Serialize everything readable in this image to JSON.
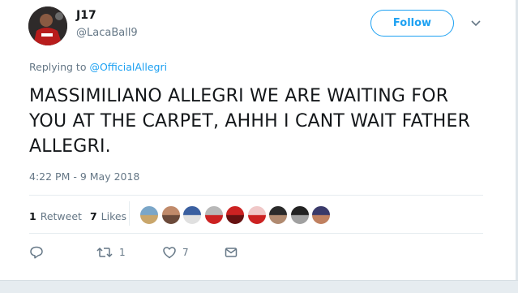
{
  "tweet": {
    "author_name": "J17",
    "author_handle": "@LacaBall9",
    "follow_label": "Follow",
    "replying_prefix": "Replying to",
    "replying_to": "@OfficialAllegri",
    "text": "MASSIMILIANO ALLEGRI WE ARE WAITING FOR YOU AT THE CARPET, AHHH I CANT WAIT FATHER ALLEGRI.",
    "timestamp": "4:22 PM - 9 May 2018",
    "retweet_count": "1",
    "retweet_label": "Retweet",
    "like_count": "7",
    "likes_label": "Likes",
    "reply_action_count": "",
    "retweet_action_count": "1",
    "like_action_count": "7"
  },
  "icons": {
    "reply": "reply-icon",
    "retweet": "retweet-icon",
    "like": "heart-icon",
    "message": "envelope-icon",
    "menu": "chevron-down-icon"
  },
  "colors": {
    "accent": "#1da1f2",
    "secondary_text": "#657786",
    "primary_text": "#14171a",
    "divider": "#e6ecf0"
  },
  "likers": [
    {
      "avatar_colors": [
        "#7aa6c8",
        "#c9a66b"
      ]
    },
    {
      "avatar_colors": [
        "#c08a6a",
        "#6b4a3a"
      ]
    },
    {
      "avatar_colors": [
        "#3a5fa0",
        "#e0e0e0"
      ]
    },
    {
      "avatar_colors": [
        "#b8b8b8",
        "#cc2222"
      ]
    },
    {
      "avatar_colors": [
        "#cc2222",
        "#661111"
      ]
    },
    {
      "avatar_colors": [
        "#f0c8c8",
        "#cc2222"
      ]
    },
    {
      "avatar_colors": [
        "#2a2a2a",
        "#b08a70"
      ]
    },
    {
      "avatar_colors": [
        "#222222",
        "#a0a0a0"
      ]
    },
    {
      "avatar_colors": [
        "#3a3a6a",
        "#c08060"
      ]
    }
  ]
}
